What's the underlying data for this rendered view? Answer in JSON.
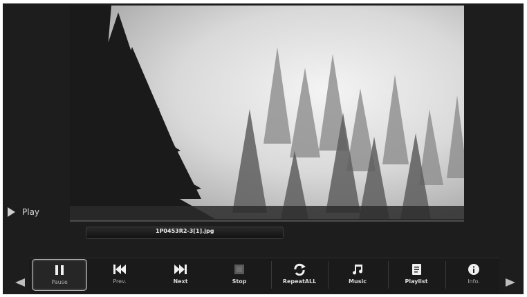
{
  "player": {
    "status_label": "Play",
    "filename": "1P0453R2-3[1].jpg"
  },
  "controls": [
    {
      "id": "pause",
      "label": "Pause",
      "icon": "pause-icon",
      "selected": true
    },
    {
      "id": "prev",
      "label": "Prev.",
      "icon": "previous-icon",
      "selected": false
    },
    {
      "id": "next",
      "label": "Next",
      "icon": "next-icon",
      "selected": false
    },
    {
      "id": "stop",
      "label": "Stop",
      "icon": "stop-icon",
      "selected": false
    },
    {
      "id": "repeat",
      "label": "RepeatALL",
      "icon": "repeat-icon",
      "selected": false
    },
    {
      "id": "music",
      "label": "Music",
      "icon": "music-note-icon",
      "selected": false
    },
    {
      "id": "playlist",
      "label": "Playlist",
      "icon": "playlist-icon",
      "selected": false
    },
    {
      "id": "info",
      "label": "Info.",
      "icon": "info-icon",
      "selected": false
    }
  ],
  "colors": {
    "background": "#1d1d1d",
    "text": "#dcdcdc"
  }
}
